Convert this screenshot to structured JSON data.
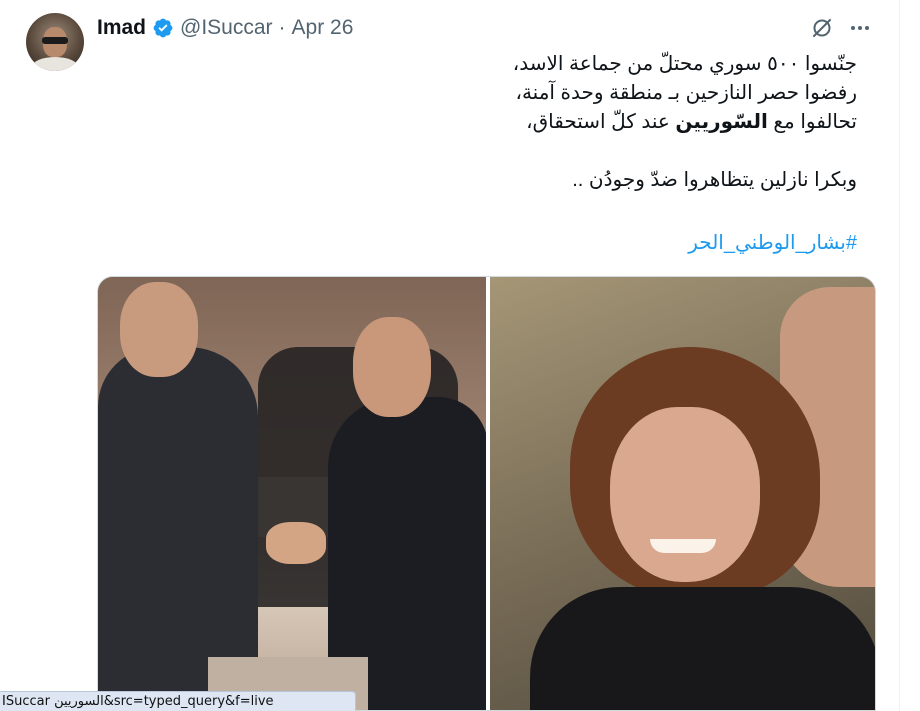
{
  "tweet": {
    "author_name": "Imad",
    "handle": "@ISuccar",
    "separator": "·",
    "date": "Apr 26",
    "text_lines": [
      "جنّسوا ٥٠٠ سوري محتلّ من جماعة الاسد،",
      "رفضوا حصر النازحين بـ منطقة وحدة آمنة،"
    ],
    "line3_before": "تحالفوا مع ",
    "line3_bold": "السّوريين",
    "line3_after": " عند كلّ استحقاق،",
    "line4": "وبكرا نازلين يتظاهروا ضدّ وجودُن ..",
    "hashtag": "#بشار_الوطني_الحر"
  },
  "icons": {
    "verified": "verified-badge-icon",
    "grok": "grok-icon",
    "more": "more-options-icon"
  },
  "colors": {
    "text": "#0f1419",
    "secondary": "#536471",
    "link": "#1d9bf0",
    "verified": "#1d9bf0"
  },
  "status_bar": {
    "url": "ISuccar السوريين&src=typed_query&f=live"
  }
}
